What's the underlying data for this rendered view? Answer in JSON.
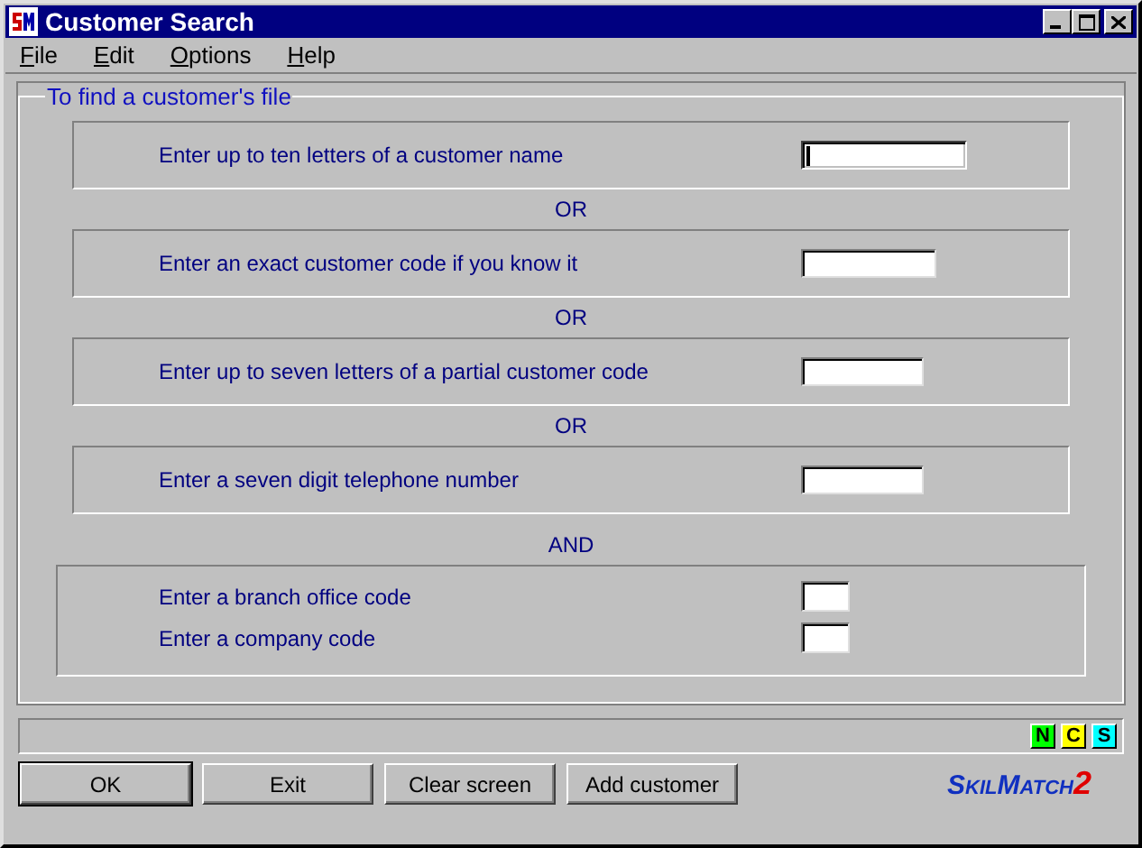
{
  "window": {
    "title": "Customer Search"
  },
  "menu": [
    {
      "access_key": "F",
      "rest": "ile"
    },
    {
      "access_key": "E",
      "rest": "dit"
    },
    {
      "access_key": "O",
      "rest": "ptions"
    },
    {
      "access_key": "H",
      "rest": "elp"
    }
  ],
  "group": {
    "title": "To find a customer's file",
    "search_options": [
      {
        "label": "Enter up to ten letters of a customer name",
        "focused": true
      },
      {
        "label": "Enter an exact customer code if you know it",
        "focused": false
      },
      {
        "label": "Enter up to seven letters of a partial customer code",
        "focused": false
      },
      {
        "label": "Enter a seven digit telephone number",
        "focused": false
      }
    ],
    "or_label": [
      "OR",
      "OR",
      "OR"
    ],
    "and_label": "AND",
    "filters": [
      {
        "label": "Enter a branch office code",
        "focused": false
      },
      {
        "label": "Enter a company code",
        "focused": false
      }
    ]
  },
  "indicators": [
    {
      "label": "N",
      "color": "#00ff00"
    },
    {
      "label": "C",
      "color": "#ffff00"
    },
    {
      "label": "S",
      "color": "#00ffff"
    }
  ],
  "buttons": [
    {
      "label": "OK",
      "default": true
    },
    {
      "label": "Exit",
      "default": false
    },
    {
      "label": "Clear screen",
      "default": false
    },
    {
      "label": "Add customer",
      "default": false
    }
  ],
  "logo": {
    "name": "SkilMatch",
    "version": "2"
  }
}
